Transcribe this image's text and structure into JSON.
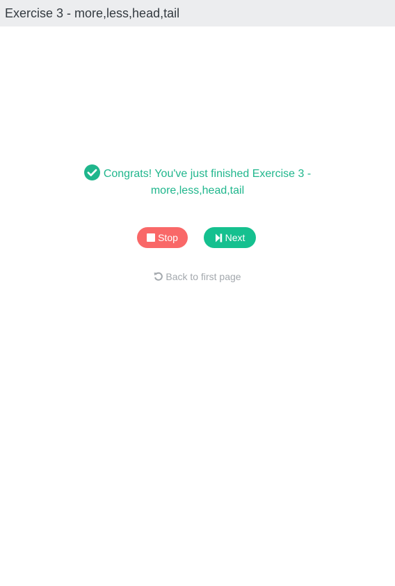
{
  "header": {
    "title": "Exercise 3 - more,less,head,tail"
  },
  "result": {
    "line1": "Congrats! You've just finished Exercise 3 -",
    "line2": "more,less,head,tail"
  },
  "actions": {
    "stop_label": "Stop",
    "next_label": "Next",
    "back_label": "Back to first page"
  },
  "colors": {
    "success": "#1fb68c",
    "stop": "#f96868",
    "next": "#15c08f",
    "muted": "#a3a8ad",
    "header_bg": "#ecedef"
  },
  "icons": {
    "result": "check-circle-icon",
    "stop": "stop-square-icon",
    "next": "step-forward-icon",
    "back": "undo-icon"
  }
}
